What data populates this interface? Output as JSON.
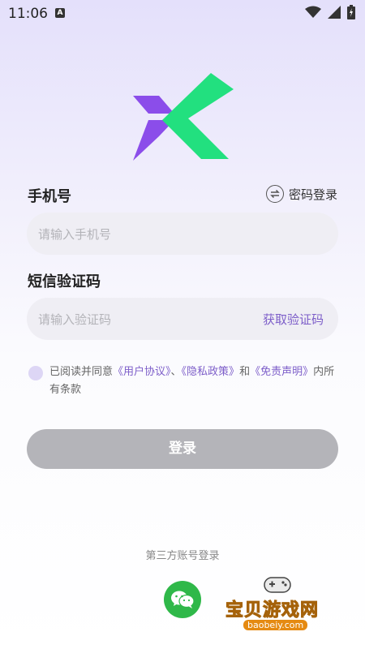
{
  "status_bar": {
    "time": "11:06",
    "a_icon": "A"
  },
  "form": {
    "phone_label": "手机号",
    "switch_label": "密码登录",
    "phone_placeholder": "请输入手机号",
    "code_label": "短信验证码",
    "code_placeholder": "请输入验证码",
    "get_code": "获取验证码"
  },
  "agreement": {
    "prefix": "已阅读并同意",
    "user_agreement": "《用户协议》",
    "sep": "、",
    "privacy": "《隐私政策》",
    "and": "和",
    "disclaimer": "《免责声明》",
    "suffix": "内所有条款"
  },
  "login_button": "登录",
  "third_party": "第三方账号登录",
  "watermark": {
    "title": "宝贝游戏网",
    "url": "baobeiy.com"
  },
  "colors": {
    "accent": "#7d5ec9",
    "logo_purple": "#8b4dea",
    "logo_green": "#22e07f",
    "button_disabled": "#b4b4b9",
    "wechat": "#2fb849"
  }
}
